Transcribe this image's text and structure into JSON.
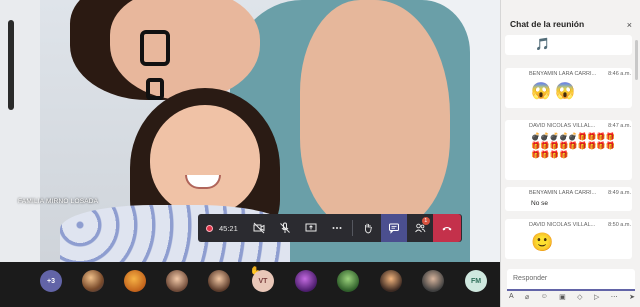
{
  "meeting": {
    "participant_name": "FAMILIA MIRNO LOSADA",
    "timer": "45:21",
    "notification_count": "1"
  },
  "toolbar": {
    "icons": [
      "record-icon",
      "camera-icon",
      "mic-off-icon",
      "share-screen-icon",
      "more-icon",
      "raise-hand-icon",
      "chat-icon",
      "participants-icon",
      "hangup-icon"
    ]
  },
  "participants_strip": {
    "overflow_label": "+3",
    "initials_vt": "VT",
    "initials_fm": "FM"
  },
  "chat": {
    "title": "Chat de la reunión",
    "messages": [
      {
        "author": "",
        "time": "",
        "content": "🎵"
      },
      {
        "author": "BENYAMIN LARA CARRI...",
        "time": "8:46 a.m.",
        "content": "😱 😱"
      },
      {
        "author": "DAVID NICOLAS VILLAL...",
        "time": "8:47 a.m.",
        "content": "💣💣💣💣💣🎁🎁🎁🎁🎁🎁🎁🎁🎁🎁🎁🎁🎁🎁🎁🎁🎁"
      },
      {
        "author": "BENYAMIN LARA CARRI...",
        "time": "8:49 a.m.",
        "content": "No se"
      },
      {
        "author": "DAVID NICOLAS VILLAL...",
        "time": "8:50 a.m.",
        "content": "🙂"
      }
    ],
    "compose_placeholder": "Responder"
  },
  "colors": {
    "accent": "#6264a7",
    "hangup": "#c4314b",
    "toolbar_bg": "#2b2b30"
  }
}
